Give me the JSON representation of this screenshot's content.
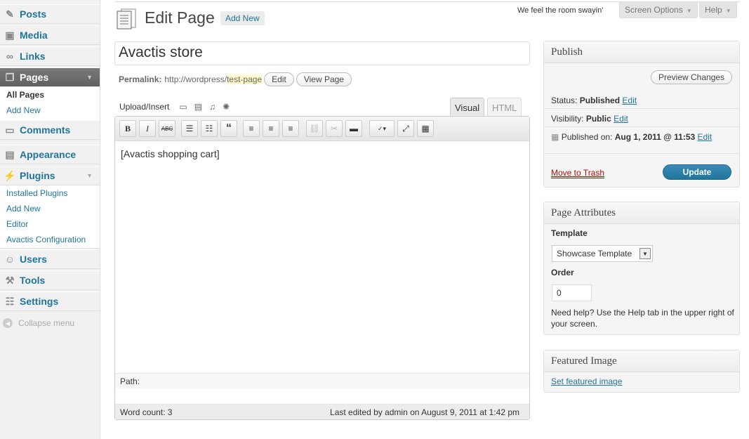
{
  "sidebar": {
    "posts": "Posts",
    "media": "Media",
    "links": "Links",
    "pages": "Pages",
    "pages_sub": [
      "All Pages",
      "Add New"
    ],
    "comments": "Comments",
    "appearance": "Appearance",
    "plugins": "Plugins",
    "plugins_sub": [
      "Installed Plugins",
      "Add New",
      "Editor",
      "Avactis Configuration"
    ],
    "users": "Users",
    "tools": "Tools",
    "settings": "Settings",
    "collapse": "Collapse menu"
  },
  "header": {
    "hello": "We feel the room swayin'",
    "screen_options": "Screen Options",
    "help": "Help",
    "title": "Edit Page",
    "add_new": "Add New"
  },
  "editor": {
    "page_title": "Avactis store",
    "permalink_label": "Permalink:",
    "permalink_base": "http://wordpress/",
    "permalink_slug": "test-page",
    "edit_btn": "Edit",
    "view_btn": "View Page",
    "upload_label": "Upload/Insert",
    "tab_visual": "Visual",
    "tab_html": "HTML",
    "content": "[Avactis shopping cart]",
    "path_label": "Path:",
    "word_count": "Word count: 3",
    "last_edited": "Last edited by admin on August 9, 2011 at 1:42 pm"
  },
  "publish": {
    "title": "Publish",
    "preview": "Preview Changes",
    "status_label": "Status:",
    "status_value": "Published",
    "visibility_label": "Visibility:",
    "visibility_value": "Public",
    "published_label": "Published on:",
    "published_value": "Aug 1, 2011 @ 11:53",
    "edit": "Edit",
    "trash": "Move to Trash",
    "update": "Update"
  },
  "attributes": {
    "title": "Page Attributes",
    "template_label": "Template",
    "template_value": "Showcase Template",
    "order_label": "Order",
    "order_value": "0",
    "help": "Need help? Use the Help tab in the upper right of your screen."
  },
  "featured": {
    "title": "Featured Image",
    "link": "Set featured image"
  }
}
